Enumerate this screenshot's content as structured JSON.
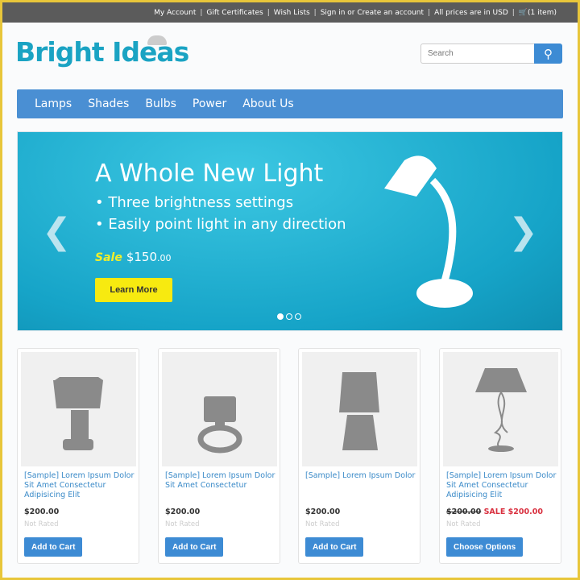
{
  "topbar": {
    "links": [
      "My Account",
      "Gift Certificates",
      "Wish Lists",
      "Sign in or Create an account",
      "All prices are in USD"
    ],
    "cart": "(1 item)"
  },
  "logo": "Bright Ideas",
  "search": {
    "placeholder": "Search"
  },
  "nav": [
    "Lamps",
    "Shades",
    "Bulbs",
    "Power",
    "About Us"
  ],
  "hero": {
    "title": "A Whole New Light",
    "bullets": [
      "• Three brightness settings",
      "• Easily point light in any direction"
    ],
    "sale_label": "Sale",
    "price": "$150",
    "cents": ".00",
    "button": "Learn More",
    "active_slide": 1,
    "slides": 3
  },
  "products": [
    {
      "title": "[Sample] Lorem Ipsum Dolor Sit Amet Consectetur Adipisicing Elit",
      "price": "$200.00",
      "rating": "Not Rated",
      "button": "Add to Cart"
    },
    {
      "title": "[Sample] Lorem Ipsum Dolor Sit Amet Consectetur",
      "price": "$200.00",
      "rating": "Not Rated",
      "button": "Add to Cart"
    },
    {
      "title": "[Sample] Lorem Ipsum Dolor",
      "price": "$200.00",
      "rating": "Not Rated",
      "button": "Add to Cart"
    },
    {
      "title": "[Sample] Lorem Ipsum Dolor Sit Amet Consectetur Adipisicing Elit",
      "price": "$200.00",
      "sale_label": "SALE",
      "sale_price": "$200.00",
      "rating": "Not Rated",
      "button": "Choose Options"
    }
  ],
  "colors": {
    "accent": "#4a8fd3",
    "logo": "#1aa3c3",
    "sale": "#d9303f",
    "cta": "#f7ea10"
  }
}
